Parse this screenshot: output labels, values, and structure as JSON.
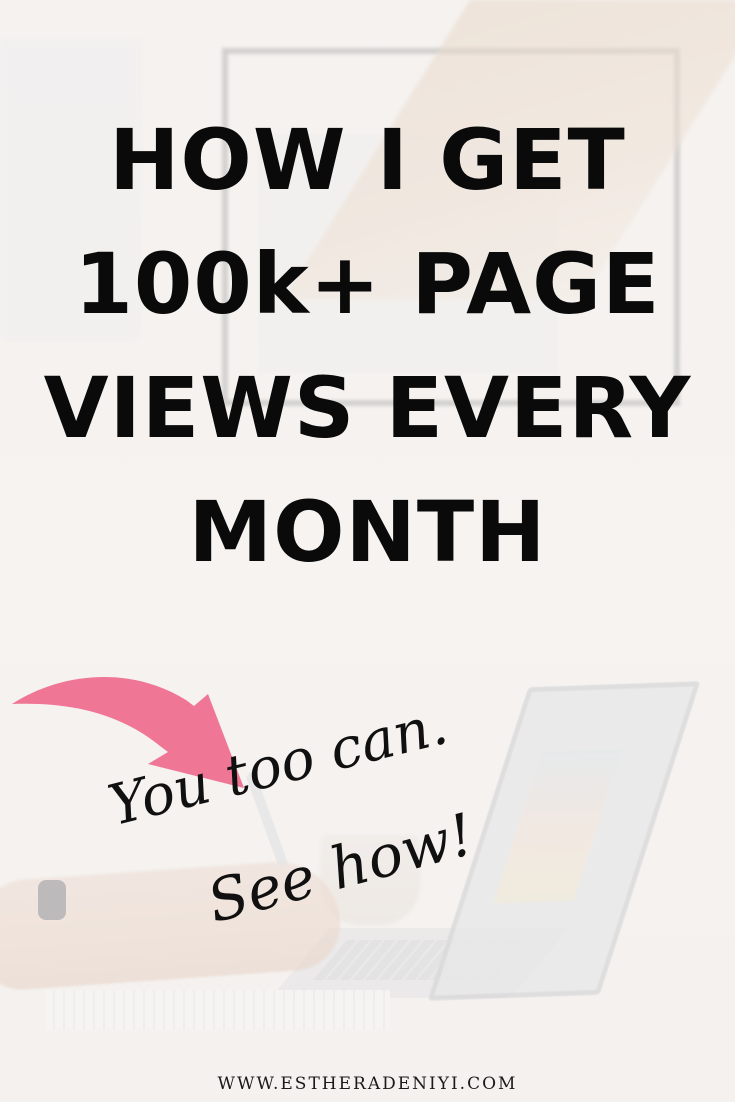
{
  "headline": {
    "lines": [
      "HOW I GET",
      "100k+ PAGE",
      "VIEWS EVERY",
      "MONTH"
    ]
  },
  "message": {
    "line1": "You too can.",
    "line2": "See how!"
  },
  "footer": {
    "url": "WWW.ESTHERADENIYI.COM"
  },
  "colors": {
    "headline": "#0a0a0a",
    "arrow": "#f07696",
    "background": "#f4f2ef"
  },
  "icons": {
    "arrow": "curved-arrow-icon"
  }
}
